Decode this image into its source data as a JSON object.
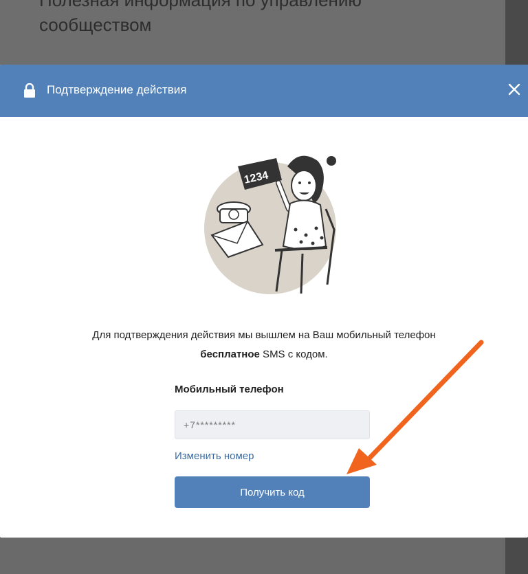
{
  "background": {
    "title_line1": "Полезная информация по управлению",
    "title_line2": "сообществом"
  },
  "modal": {
    "title": "Подтверждение действия",
    "illustration_sign": "1234",
    "description_main": "Для подтверждения действия мы вышлем на Ваш мобильный телефон",
    "description_bold": "бесплатное",
    "description_tail": " SMS с кодом.",
    "phone_label": "Мобильный телефон",
    "phone_value": "+7*********",
    "change_number_link": "Изменить номер",
    "submit_label": "Получить код"
  },
  "colors": {
    "header_blue": "#5181b8",
    "annotation_arrow": "#f0641e"
  },
  "icons": {
    "lock": "lock-icon",
    "close": "close-icon"
  }
}
